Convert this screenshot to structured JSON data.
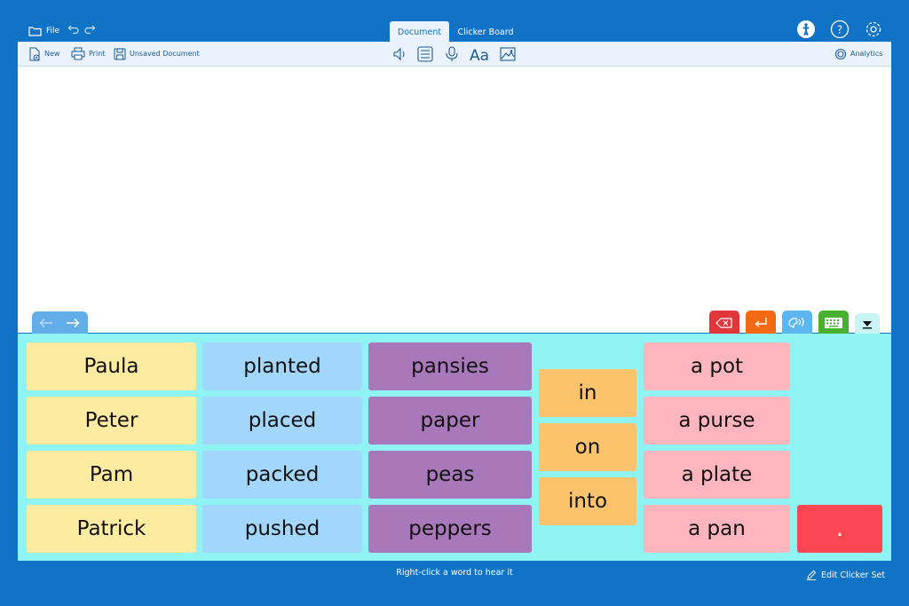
{
  "topbar": {
    "file_label": "File",
    "tabs": [
      {
        "label": "Document",
        "active": true
      },
      {
        "label": "Clicker Board",
        "active": false
      }
    ],
    "right_icons": [
      "accessibility-icon",
      "help-icon",
      "settings-icon"
    ]
  },
  "toolbar": {
    "new_label": "New",
    "print_label": "Print",
    "save_label": "Unsaved Document",
    "center_icons": [
      "speaker-icon",
      "word-list-icon",
      "microphone-icon",
      "font-icon",
      "image-icon"
    ],
    "analytics_label": "Analytics"
  },
  "document": {
    "text": ""
  },
  "actions": [
    {
      "name": "backspace",
      "color": "#e0353b"
    },
    {
      "name": "enter",
      "color": "#f36a13"
    },
    {
      "name": "speak",
      "color": "#5cb6f0"
    },
    {
      "name": "keyboard",
      "color": "#46b22f"
    },
    {
      "name": "collapse",
      "color": "#c9f4f8"
    }
  ],
  "grid": {
    "col1": [
      "Paula",
      "Peter",
      "Pam",
      "Patrick"
    ],
    "col2": [
      "planted",
      "placed",
      "packed",
      "pushed"
    ],
    "col3": [
      "pansies",
      "paper",
      "peas",
      "peppers"
    ],
    "col4": [
      "in",
      "on",
      "into"
    ],
    "col5": [
      "a pot",
      "a purse",
      "a plate",
      "a pan"
    ],
    "period": ".",
    "colors": {
      "names": "#feeba2",
      "verbs": "#a2d6fb",
      "nouns": "#a878bb",
      "prepositions": "#fdc36c",
      "objects": "#feb5bd",
      "period": "#fc4651"
    }
  },
  "status": {
    "hint": "Right-click a word to hear it",
    "edit_label": "Edit Clicker Set"
  }
}
